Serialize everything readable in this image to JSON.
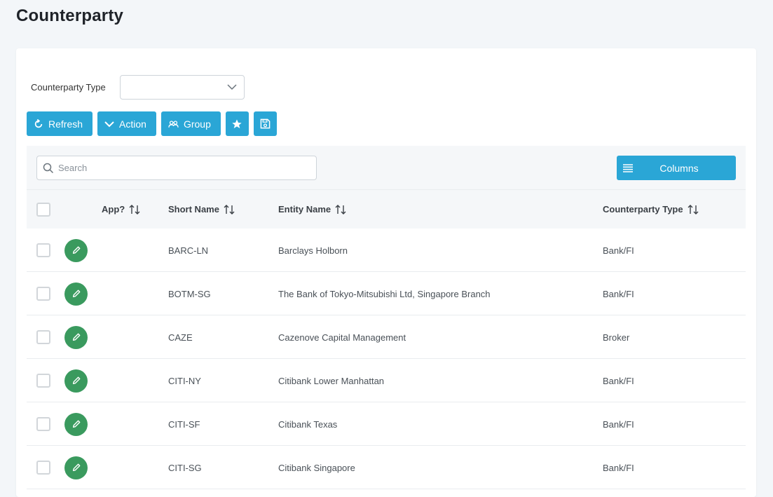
{
  "page": {
    "title": "Counterparty"
  },
  "filter": {
    "label": "Counterparty Type",
    "selected": ""
  },
  "toolbar": {
    "refresh_label": "Refresh",
    "action_label": "Action",
    "group_label": "Group"
  },
  "search": {
    "placeholder": "Search"
  },
  "columns_button": {
    "label": "Columns"
  },
  "table": {
    "headers": {
      "app": "App?",
      "short_name": "Short Name",
      "entity_name": "Entity Name",
      "counterparty_type": "Counterparty Type"
    },
    "rows": [
      {
        "short_name": "BARC-LN",
        "entity_name": "Barclays Holborn",
        "counterparty_type": "Bank/FI"
      },
      {
        "short_name": "BOTM-SG",
        "entity_name": "The Bank of Tokyo-Mitsubishi Ltd, Singapore Branch",
        "counterparty_type": "Bank/FI"
      },
      {
        "short_name": "CAZE",
        "entity_name": "Cazenove Capital Management",
        "counterparty_type": "Broker"
      },
      {
        "short_name": "CITI-NY",
        "entity_name": "Citibank Lower Manhattan",
        "counterparty_type": "Bank/FI"
      },
      {
        "short_name": "CITI-SF",
        "entity_name": "Citibank Texas",
        "counterparty_type": "Bank/FI"
      },
      {
        "short_name": "CITI-SG",
        "entity_name": "Citibank Singapore",
        "counterparty_type": "Bank/FI"
      }
    ]
  },
  "colors": {
    "primary": "#2aa6d6",
    "edit": "#3a9a5e",
    "background": "#f3f6f9",
    "header_bg": "#f5f7f9"
  },
  "icons": {
    "refresh": "refresh-icon",
    "action": "chevron-down-icon",
    "group": "group-icon",
    "favorite": "star-icon",
    "save": "save-icon",
    "search": "search-icon",
    "columns": "list-icon",
    "edit": "pencil-icon",
    "sort": "sort-icon"
  }
}
